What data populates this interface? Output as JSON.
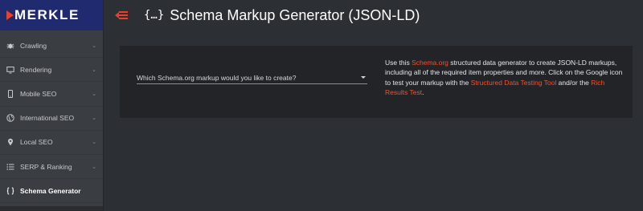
{
  "brand": {
    "name": "MERKLE"
  },
  "header": {
    "title": "Schema Markup Generator (JSON-LD)",
    "title_icon": "{…}"
  },
  "sidebar": {
    "items": [
      {
        "label": "Crawling",
        "icon": "bug-icon"
      },
      {
        "label": "Rendering",
        "icon": "screen-icon"
      },
      {
        "label": "Mobile SEO",
        "icon": "mobile-icon"
      },
      {
        "label": "International SEO",
        "icon": "globe-icon"
      },
      {
        "label": "Local SEO",
        "icon": "location-pin-icon"
      },
      {
        "label": "SERP & Ranking",
        "icon": "list-icon"
      },
      {
        "label": "Schema Generator",
        "icon": "braces-icon",
        "active": true
      }
    ]
  },
  "main": {
    "select_label": "Which Schema.org markup would you like to create?",
    "description": {
      "t1": "Use this ",
      "link1": "Schema.org",
      "t2": " structured data generator to create JSON-LD markups, including all of the required item properties and more. Click on the Google icon to test your markup with the ",
      "link2": "Structured Data Testing Tool",
      "t3": " and/or the ",
      "link3": "Rich Results Test",
      "t4": "."
    }
  },
  "colors": {
    "accent": "#e8402b",
    "brand_bg": "#1f2a6f",
    "sidebar_bg": "#3a3d42",
    "page_bg": "#2c2f33",
    "card_bg": "#222428",
    "link": "#f0522f"
  }
}
